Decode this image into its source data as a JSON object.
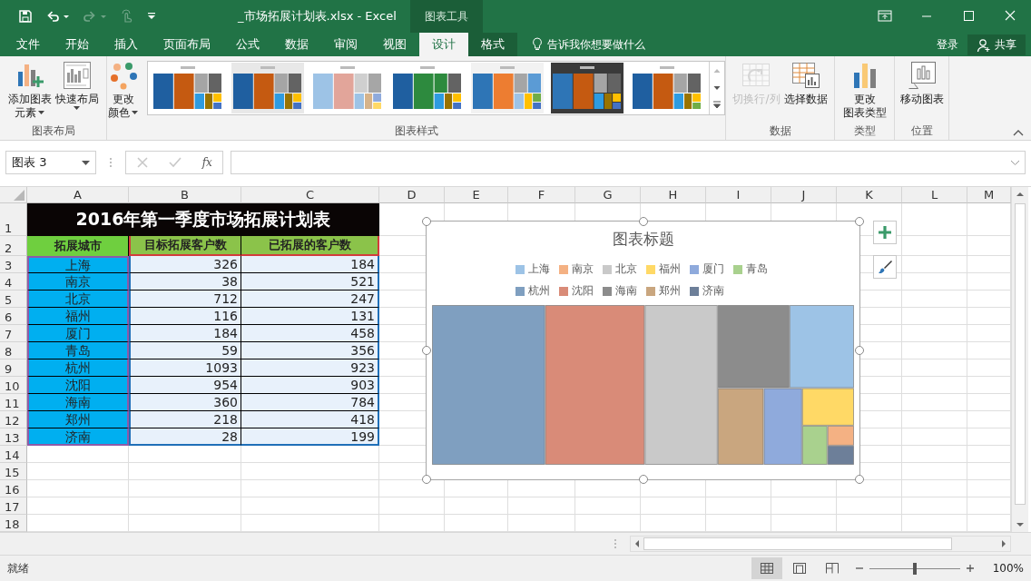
{
  "window": {
    "title": "_市场拓展计划表.xlsx - Excel",
    "context_label": "图表工具"
  },
  "quick_access": [
    {
      "kind": "save",
      "disabled": false
    },
    {
      "kind": "undo",
      "disabled": false
    },
    {
      "kind": "redo",
      "disabled": true
    },
    {
      "kind": "touch",
      "disabled": true
    },
    {
      "kind": "customize",
      "disabled": false
    }
  ],
  "menu_tabs": [
    {
      "label": "文件",
      "selected": false,
      "context": false
    },
    {
      "label": "开始",
      "selected": false,
      "context": false
    },
    {
      "label": "插入",
      "selected": false,
      "context": false
    },
    {
      "label": "页面布局",
      "selected": false,
      "context": false
    },
    {
      "label": "公式",
      "selected": false,
      "context": false
    },
    {
      "label": "数据",
      "selected": false,
      "context": false
    },
    {
      "label": "审阅",
      "selected": false,
      "context": false
    },
    {
      "label": "视图",
      "selected": false,
      "context": false
    },
    {
      "label": "设计",
      "selected": true,
      "context": true
    },
    {
      "label": "格式",
      "selected": false,
      "context": true
    }
  ],
  "tell_me": "告诉我你想要做什么",
  "sign_in": "登录",
  "share": "共享",
  "ribbon": {
    "groups": [
      {
        "label": "图表布局",
        "kind": "buttons",
        "buttons": [
          {
            "kind": "add-element",
            "lines": [
              "添加图表",
              "元素"
            ],
            "dropdown": true,
            "disabled": false
          },
          {
            "kind": "quick-layout",
            "lines": [
              "快速布局"
            ],
            "dropdown": true,
            "disabled": false
          }
        ]
      },
      {
        "label": "图表样式",
        "kind": "styles",
        "buttons": [
          {
            "kind": "colors",
            "lines": [
              "更改",
              "颜色"
            ],
            "dropdown": true,
            "disabled": false
          }
        ]
      },
      {
        "label": "数据",
        "kind": "buttons",
        "buttons": [
          {
            "kind": "switch",
            "lines": [
              "切换行/列"
            ],
            "dropdown": false,
            "disabled": true
          },
          {
            "kind": "select-data",
            "lines": [
              "选择数据"
            ],
            "dropdown": false,
            "disabled": false
          }
        ]
      },
      {
        "label": "类型",
        "kind": "buttons",
        "buttons": [
          {
            "kind": "chart-type",
            "lines": [
              "更改",
              "图表类型"
            ],
            "dropdown": false,
            "disabled": false
          }
        ]
      },
      {
        "label": "位置",
        "kind": "buttons",
        "buttons": [
          {
            "kind": "move-chart",
            "lines": [
              "移动图表"
            ],
            "dropdown": false,
            "disabled": false
          }
        ]
      }
    ]
  },
  "formula_bar": {
    "name_box": "图表 3",
    "function_label": "fx"
  },
  "sheet": {
    "columns": [
      "A",
      "B",
      "C",
      "D",
      "E",
      "F",
      "G",
      "H",
      "I",
      "J",
      "K",
      "L",
      "M"
    ],
    "rows": [
      "1",
      "2",
      "3",
      "4",
      "5",
      "6",
      "7",
      "8",
      "9",
      "10",
      "11",
      "12",
      "13",
      "14",
      "15",
      "16",
      "17",
      "18"
    ],
    "title": "2016年第一季度市场拓展计划表",
    "headers": [
      "拓展城市",
      "目标拓展客户数",
      "已拓展的客户数"
    ],
    "data": [
      [
        "上海",
        "326",
        "184"
      ],
      [
        "南京",
        "38",
        "521"
      ],
      [
        "北京",
        "712",
        "247"
      ],
      [
        "福州",
        "116",
        "131"
      ],
      [
        "厦门",
        "184",
        "458"
      ],
      [
        "青岛",
        "59",
        "356"
      ],
      [
        "杭州",
        "1093",
        "923"
      ],
      [
        "沈阳",
        "954",
        "903"
      ],
      [
        "海南",
        "360",
        "784"
      ],
      [
        "郑州",
        "218",
        "418"
      ],
      [
        "济南",
        "28",
        "199"
      ]
    ]
  },
  "chart": {
    "title": "图表标题",
    "legend": [
      {
        "label": "上海",
        "color": "#9dc3e6"
      },
      {
        "label": "南京",
        "color": "#f4b183"
      },
      {
        "label": "北京",
        "color": "#c9c9c9"
      },
      {
        "label": "福州",
        "color": "#ffd966"
      },
      {
        "label": "厦门",
        "color": "#8faadc"
      },
      {
        "label": "青岛",
        "color": "#a9d18e"
      },
      {
        "label": "杭州",
        "color": "#7f9fc0"
      },
      {
        "label": "沈阳",
        "color": "#d98b78"
      },
      {
        "label": "海南",
        "color": "#8c8c8c"
      },
      {
        "label": "郑州",
        "color": "#c9a67f"
      },
      {
        "label": "济南",
        "color": "#6d7f99"
      }
    ]
  },
  "status_bar": {
    "text": "就绪",
    "views": [
      {
        "kind": "normal",
        "selected": true
      },
      {
        "kind": "page-layout",
        "selected": false
      },
      {
        "kind": "page-break",
        "selected": false
      }
    ],
    "zoom": {
      "level": 0.5,
      "reading": "100%"
    }
  }
}
